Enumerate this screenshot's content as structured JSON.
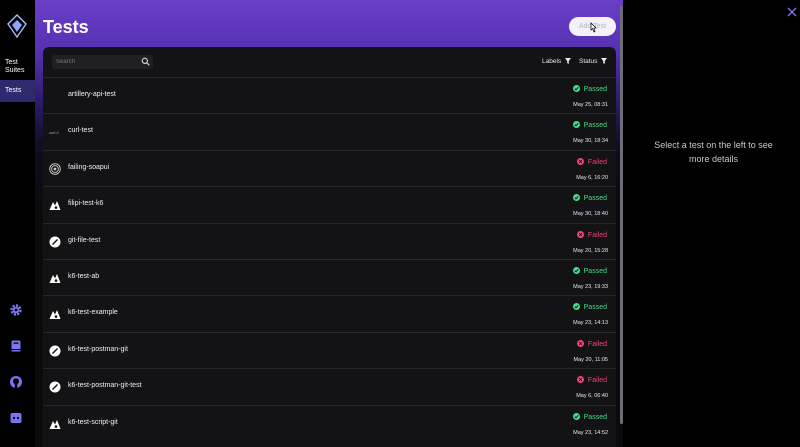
{
  "colors": {
    "accent": "#6b3fc8",
    "icon_purple": "#7b74f0",
    "passed": "#4ad98b",
    "failed": "#f0447a"
  },
  "sidebar": {
    "items": [
      {
        "label": "Test Suites",
        "icon": "none"
      },
      {
        "label": "Tests",
        "icon": "none",
        "active": true
      }
    ],
    "bottom_icons": [
      "gear-icon",
      "book-icon",
      "github-icon",
      "discord-icon"
    ]
  },
  "header": {
    "title": "Tests",
    "add_button": "Add Test"
  },
  "toolbar": {
    "search_placeholder": "Search",
    "labels_filter": "Labels",
    "status_filter": "Status"
  },
  "tests": [
    {
      "name": "artillery-api-test",
      "icon": "blank",
      "status": "Passed",
      "date": "May 25, 08:31"
    },
    {
      "name": "curl-test",
      "icon": "curl-icon",
      "status": "Passed",
      "date": "May 30, 18:34"
    },
    {
      "name": "failing-soapui",
      "icon": "soapui-icon",
      "status": "Failed",
      "date": "May 6, 16:20"
    },
    {
      "name": "filipi-test-k6",
      "icon": "k6-icon",
      "status": "Passed",
      "date": "May 30, 18:40"
    },
    {
      "name": "git-file-test",
      "icon": "postman-icon",
      "status": "Failed",
      "date": "May 20, 15:28"
    },
    {
      "name": "k6-test-ab",
      "icon": "k6-icon",
      "status": "Passed",
      "date": "May 23, 19:33"
    },
    {
      "name": "k6-test-example",
      "icon": "k6-icon",
      "status": "Passed",
      "date": "May 23, 14:13"
    },
    {
      "name": "k6-test-postman-git",
      "icon": "postman-icon",
      "status": "Failed",
      "date": "May 20, 11:05"
    },
    {
      "name": "k6-test-postman-git-test",
      "icon": "postman-icon",
      "status": "Failed",
      "date": "May 6, 06:40"
    },
    {
      "name": "k6-test-script-git",
      "icon": "k6-icon",
      "status": "Passed",
      "date": "May 23, 14:52"
    }
  ],
  "detail": {
    "empty_message": "Select a test on the left to see more details"
  }
}
